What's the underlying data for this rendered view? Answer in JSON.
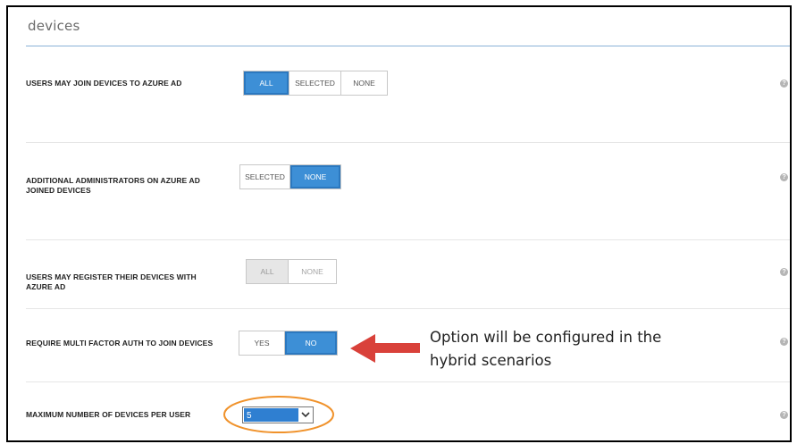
{
  "section": {
    "title": "devices"
  },
  "rows": [
    {
      "label": "USERS MAY JOIN DEVICES TO AZURE AD",
      "options": [
        "ALL",
        "SELECTED",
        "NONE"
      ],
      "selected": "ALL"
    },
    {
      "label": "ADDITIONAL ADMINISTRATORS ON AZURE AD JOINED DEVICES",
      "options": [
        "SELECTED",
        "NONE"
      ],
      "selected": "NONE"
    },
    {
      "label": "USERS MAY REGISTER THEIR DEVICES WITH AZURE AD",
      "options": [
        "ALL",
        "NONE"
      ],
      "selected": "ALL",
      "disabled": true
    },
    {
      "label": "REQUIRE MULTI FACTOR AUTH TO JOIN DEVICES",
      "options": [
        "YES",
        "NO"
      ],
      "selected": "NO"
    },
    {
      "label": "MAXIMUM NUMBER OF DEVICES PER USER",
      "select_value": "5"
    }
  ],
  "annotation": {
    "text": "Option will be configured in the hybrid scenarios",
    "arrow_color": "#d9413a",
    "ellipse_color": "#f0922b"
  },
  "help_icon_glyph": "?",
  "colors": {
    "accent": "#3d8fd6",
    "rule": "#8ab2d8"
  }
}
